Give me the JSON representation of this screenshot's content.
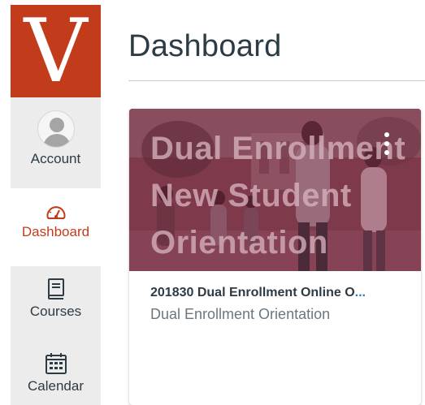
{
  "brand": {
    "logo_letter": "V",
    "accent_color": "#c23c1c"
  },
  "global_nav": {
    "items": [
      {
        "label": "Account",
        "icon": "avatar-icon"
      },
      {
        "label": "Dashboard",
        "icon": "dashboard-gauge-icon",
        "active": true
      },
      {
        "label": "Courses",
        "icon": "book-icon"
      },
      {
        "label": "Calendar",
        "icon": "calendar-icon"
      }
    ]
  },
  "page": {
    "title": "Dashboard"
  },
  "course_card": {
    "hero_text": [
      "Dual Enrollment",
      "New Student",
      "Orientation"
    ],
    "hero_color": "#7e3a4b",
    "title": "201830 Dual Enrollment Online O",
    "title_ellipsis": "...",
    "subtitle": "Dual Enrollment Orientation",
    "menu_icon": "kebab-menu-icon"
  }
}
